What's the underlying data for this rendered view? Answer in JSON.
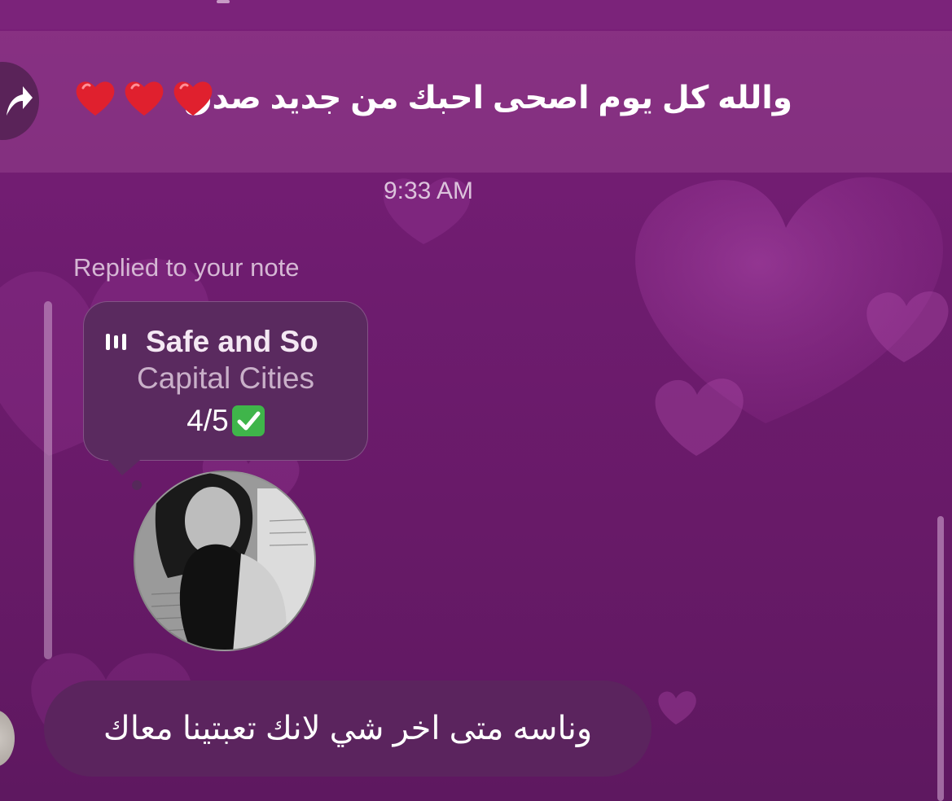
{
  "thread": {
    "message_1": {
      "text": "والله كل يوم اصحى احبك من جديد صدق",
      "emojis": [
        "red-heart",
        "red-heart",
        "red-heart"
      ]
    },
    "timestamp": "9:33 AM",
    "reply_context": {
      "label": "Replied to your note",
      "note": {
        "song_title": "Safe and So",
        "artist": "Capital Cities",
        "text": "4/5",
        "emoji": "check-mark-button"
      }
    },
    "message_2": {
      "text": "وناسه متى اخر شي لانك تعبتينا معاك"
    }
  },
  "colors": {
    "background": "#6e1c6f",
    "highlight": "#a0509a",
    "bubble": "#5b245e",
    "note_bubble": "#5a2a5f",
    "heart_emoji": "#e0202e",
    "check_green": "#3fb54a"
  },
  "icons": {
    "share": "share-arrow-icon",
    "music": "music-bars-icon"
  }
}
